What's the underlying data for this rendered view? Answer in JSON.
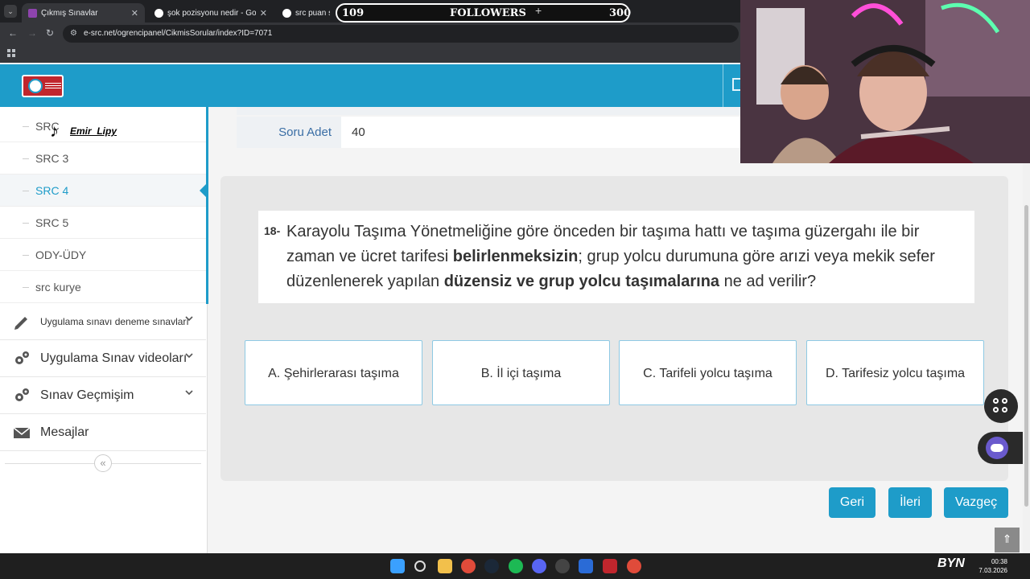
{
  "browser": {
    "tabs": [
      {
        "title": "Çıkmış Sınavlar"
      },
      {
        "title": "şok pozisyonu nedir - Google'd"
      },
      {
        "title": "src puan sınırı"
      }
    ],
    "url": "e-src.net/ogrencipanel/CikmisSorular/index?ID=7071"
  },
  "followers_widget": {
    "left": "109",
    "label": "FOLLOWERS",
    "right": "300"
  },
  "tiktok": {
    "handle": "Emir_Lipy"
  },
  "sidebar": {
    "sub_items": [
      {
        "label": "SRC"
      },
      {
        "label": "SRC 3"
      },
      {
        "label": "SRC 4"
      },
      {
        "label": "SRC 5"
      },
      {
        "label": "ODY-ÜDY"
      },
      {
        "label": "src kurye"
      }
    ],
    "menu": [
      {
        "label": "Uygulama sınavı deneme sınavları",
        "icon": "pencil-icon"
      },
      {
        "label": "Uygulama Sınav videoları",
        "icon": "gears-icon"
      },
      {
        "label": "Sınav Geçmişim",
        "icon": "gears-icon"
      },
      {
        "label": "Mesajlar",
        "icon": "envelope-icon"
      }
    ],
    "collapse_glyph": "«"
  },
  "info": {
    "label": "Soru Adet",
    "value": "40"
  },
  "question": {
    "number": "18-",
    "text_parts": [
      {
        "t": "Karayolu Taşıma Yönetmeliğine göre önceden bir taşıma hattı ve taşıma güzergahı ile bir zaman ve ücret tarifesi ",
        "b": false
      },
      {
        "t": "belirlenmeksizin",
        "b": true
      },
      {
        "t": "; grup yolcu durumuna göre arızi veya mekik sefer düzenlenerek yapılan ",
        "b": false
      },
      {
        "t": "düzensiz ve grup yolcu taşımalarına",
        "b": true
      },
      {
        "t": " ne ad verilir?",
        "b": false
      }
    ]
  },
  "options": [
    {
      "label": "A. Şehirlerarası taşıma"
    },
    {
      "label": "B. İl içi taşıma"
    },
    {
      "label": "C. Tarifeli yolcu taşıma"
    },
    {
      "label": "D. Tarifesiz yolcu taşıma"
    }
  ],
  "buttons": {
    "back": "Geri",
    "next": "İleri",
    "cancel": "Vazgeç"
  },
  "scroll_top_glyph": "⇑",
  "taskbar": {
    "time": "00:38",
    "date": "7.03.2026",
    "overlay_text": "BYN"
  },
  "colors": {
    "accent": "#1e9cc9",
    "card_bg": "#e7e7e7",
    "option_border": "#8ec9e4"
  }
}
